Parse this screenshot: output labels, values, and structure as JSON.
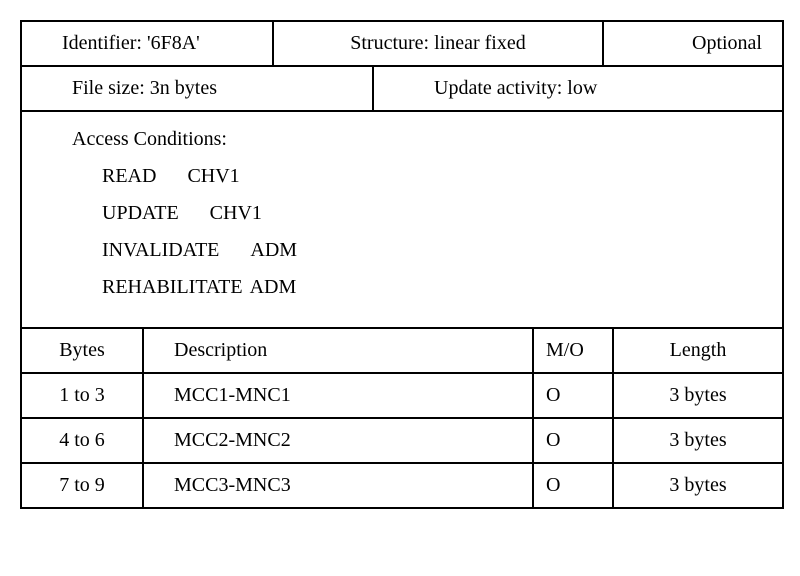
{
  "header": {
    "identifier_label": "Identifier: '6F8A'",
    "structure_label": "Structure: linear fixed",
    "optional_label": "Optional",
    "filesize_label": "File size: 3n bytes",
    "update_label": "Update activity: low"
  },
  "access": {
    "title": "Access Conditions:",
    "items": [
      {
        "op": "READ",
        "val": "CHV1"
      },
      {
        "op": "UPDATE",
        "val": "CHV1"
      },
      {
        "op": "INVALIDATE",
        "val": "ADM"
      },
      {
        "op": "REHABILITATE",
        "val": "ADM"
      }
    ]
  },
  "columns": {
    "bytes": "Bytes",
    "description": "Description",
    "mo": "M/O",
    "length": "Length"
  },
  "rows": [
    {
      "bytes": "1 to 3",
      "description": "MCC1-MNC1",
      "mo": "O",
      "length": "3 bytes"
    },
    {
      "bytes": "4 to 6",
      "description": "MCC2-MNC2",
      "mo": "O",
      "length": "3 bytes"
    },
    {
      "bytes": "7 to 9",
      "description": "MCC3-MNC3",
      "mo": "O",
      "length": "3 bytes"
    }
  ]
}
